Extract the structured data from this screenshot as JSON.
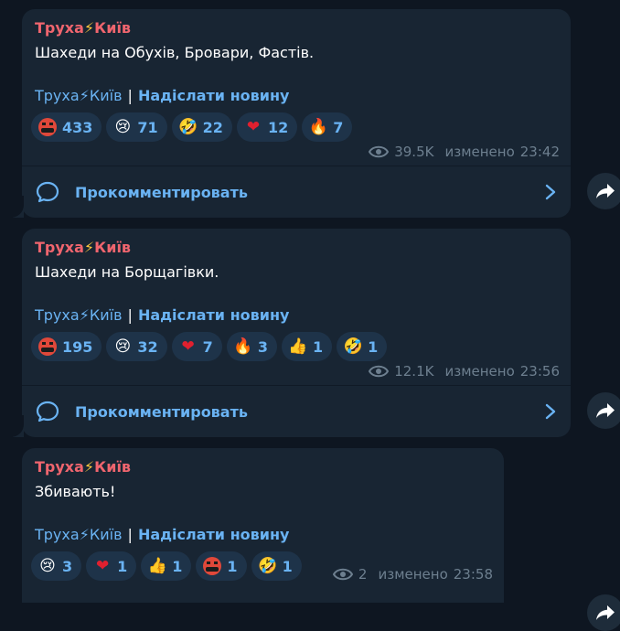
{
  "posts": [
    {
      "author": "Труха",
      "author_bolt": "⚡",
      "author_city": "Київ",
      "text": "Шахеди на Обухів, Бровари, Фастів.",
      "link_channel": "Труха⚡Київ",
      "link_sep": "|",
      "link_send": "Надіслати новину",
      "reactions": [
        {
          "icon": "angry-face-icon",
          "count": "433"
        },
        {
          "icon": "crying-face-icon",
          "glyph": "😢",
          "count": "71"
        },
        {
          "icon": "rolling-laughing-icon",
          "glyph": "🤣",
          "count": "22"
        },
        {
          "icon": "red-heart-icon",
          "glyph": "❤",
          "count": "12"
        },
        {
          "icon": "fire-icon",
          "glyph": "🔥",
          "count": "7"
        }
      ],
      "views": "39.5K",
      "edited_label": "изменено",
      "time": "23:42",
      "comment_label": "Прокомментировать"
    },
    {
      "author": "Труха",
      "author_bolt": "⚡",
      "author_city": "Київ",
      "text": "Шахеди на Борщагівки.",
      "link_channel": "Труха⚡Київ",
      "link_sep": "|",
      "link_send": "Надіслати новину",
      "reactions": [
        {
          "icon": "angry-face-icon",
          "count": "195"
        },
        {
          "icon": "crying-face-icon",
          "glyph": "😢",
          "count": "32"
        },
        {
          "icon": "red-heart-icon",
          "glyph": "❤",
          "count": "7"
        },
        {
          "icon": "fire-icon",
          "glyph": "🔥",
          "count": "3"
        },
        {
          "icon": "thumbs-up-icon",
          "glyph": "👍",
          "count": "1"
        },
        {
          "icon": "rolling-laughing-icon",
          "glyph": "🤣",
          "count": "1"
        }
      ],
      "views": "12.1K",
      "edited_label": "изменено",
      "time": "23:56",
      "comment_label": "Прокомментировать"
    },
    {
      "author": "Труха",
      "author_bolt": "⚡",
      "author_city": "Київ",
      "text": "Збивають!",
      "link_channel": "Труха⚡Київ",
      "link_sep": "|",
      "link_send": "Надіслати новину",
      "reactions": [
        {
          "icon": "crying-face-icon",
          "glyph": "😢",
          "count": "3"
        },
        {
          "icon": "red-heart-icon",
          "glyph": "❤",
          "count": "1"
        },
        {
          "icon": "thumbs-up-icon",
          "glyph": "👍",
          "count": "1"
        },
        {
          "icon": "angry-face-icon",
          "count": "1"
        },
        {
          "icon": "rolling-laughing-icon",
          "glyph": "🤣",
          "count": "1"
        }
      ],
      "views": "2",
      "edited_label": "изменено",
      "time": "23:58"
    }
  ],
  "colors": {
    "background": "#0e1621",
    "bubble": "#182533",
    "author": "#f0656e",
    "link": "#6ab3f3",
    "reaction_bg": "#1e3349",
    "meta": "#6d7f8f"
  }
}
